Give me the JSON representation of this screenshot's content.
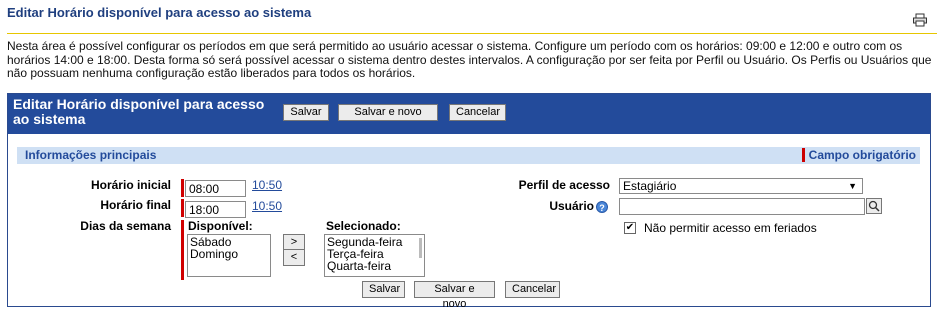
{
  "page": {
    "title": "Editar Horário disponível para acesso ao sistema",
    "intro": "Nesta área é possível configurar os períodos em que será permitido ao usuário acessar o sistema. Configure um período com os horários: 09:00 e 12:00 e outro com os horários 14:00 e 18:00. Desta forma só será possível acessar o sistema dentro destes intervalos. A configuração por ser feita por Perfil ou Usuário. Os Perfis ou Usuários que não possuam nenhuma configuração estão liberados para todos os horários."
  },
  "form": {
    "header_title": "Editar Horário disponível para acesso ao sistema",
    "buttons": {
      "save": "Salvar",
      "save_new": "Salvar e novo",
      "cancel": "Cancelar"
    },
    "section": {
      "title": "Informações principais",
      "required": "Campo obrigatório"
    },
    "horario_inicial": {
      "label": "Horário inicial",
      "value": "08:00",
      "link": "10:50"
    },
    "horario_final": {
      "label": "Horário final",
      "value": "18:00",
      "link": "10:50"
    },
    "dias": {
      "label": "Dias da semana",
      "available_label": "Disponível:",
      "available": [
        "Sábado",
        "Domingo"
      ],
      "selected_label": "Selecionado:",
      "selected": [
        "Segunda-feira",
        "Terça-feira",
        "Quarta-feira"
      ],
      "add_btn": ">",
      "remove_btn": "<"
    },
    "perfil": {
      "label": "Perfil de acesso",
      "value": "Estagiário"
    },
    "usuario": {
      "label": "Usuário",
      "value": ""
    },
    "feriados": {
      "label": "Não permitir acesso em feriados",
      "checked": true
    },
    "icons": {
      "print": "printer-icon",
      "help": "help-icon",
      "search": "search-icon",
      "caret": "chevron-down-icon"
    },
    "colors": {
      "header_bg": "#234b9b",
      "section_bg": "#cfe0f4",
      "required_bar": "#d00000",
      "title_rule": "#e6c600"
    }
  }
}
